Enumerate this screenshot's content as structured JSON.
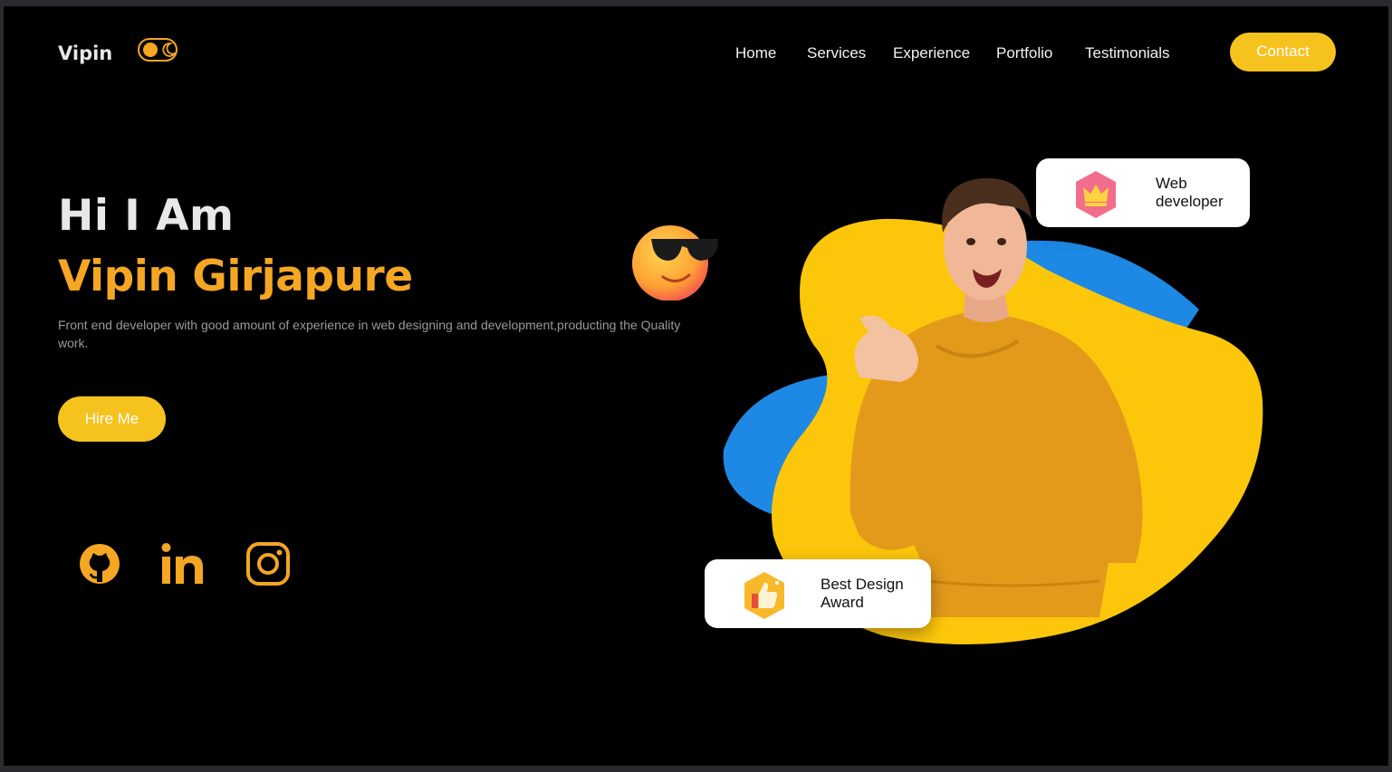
{
  "header": {
    "logo": "Vipin",
    "theme_toggle_icon": "moon-icon",
    "nav": [
      "Home",
      "Services",
      "Experience",
      "Portfolio",
      "Testimonials"
    ],
    "contact_label": "Contact"
  },
  "hero": {
    "greeting": "Hi I Am",
    "name": "Vipin Girjapure",
    "description": "Front end developer with good amount of experience in web designing and development,producting the Quality work.",
    "hire_label": "Hire Me"
  },
  "social": [
    "github-icon",
    "linkedin-icon",
    "instagram-icon"
  ],
  "badges": {
    "web": "Web developer",
    "award": "Best Design Award"
  },
  "colors": {
    "accent": "#f5a623",
    "button": "#f6c21e",
    "blob_yellow": "#fcc60a",
    "blob_blue": "#1e88e5",
    "background": "#000000"
  }
}
